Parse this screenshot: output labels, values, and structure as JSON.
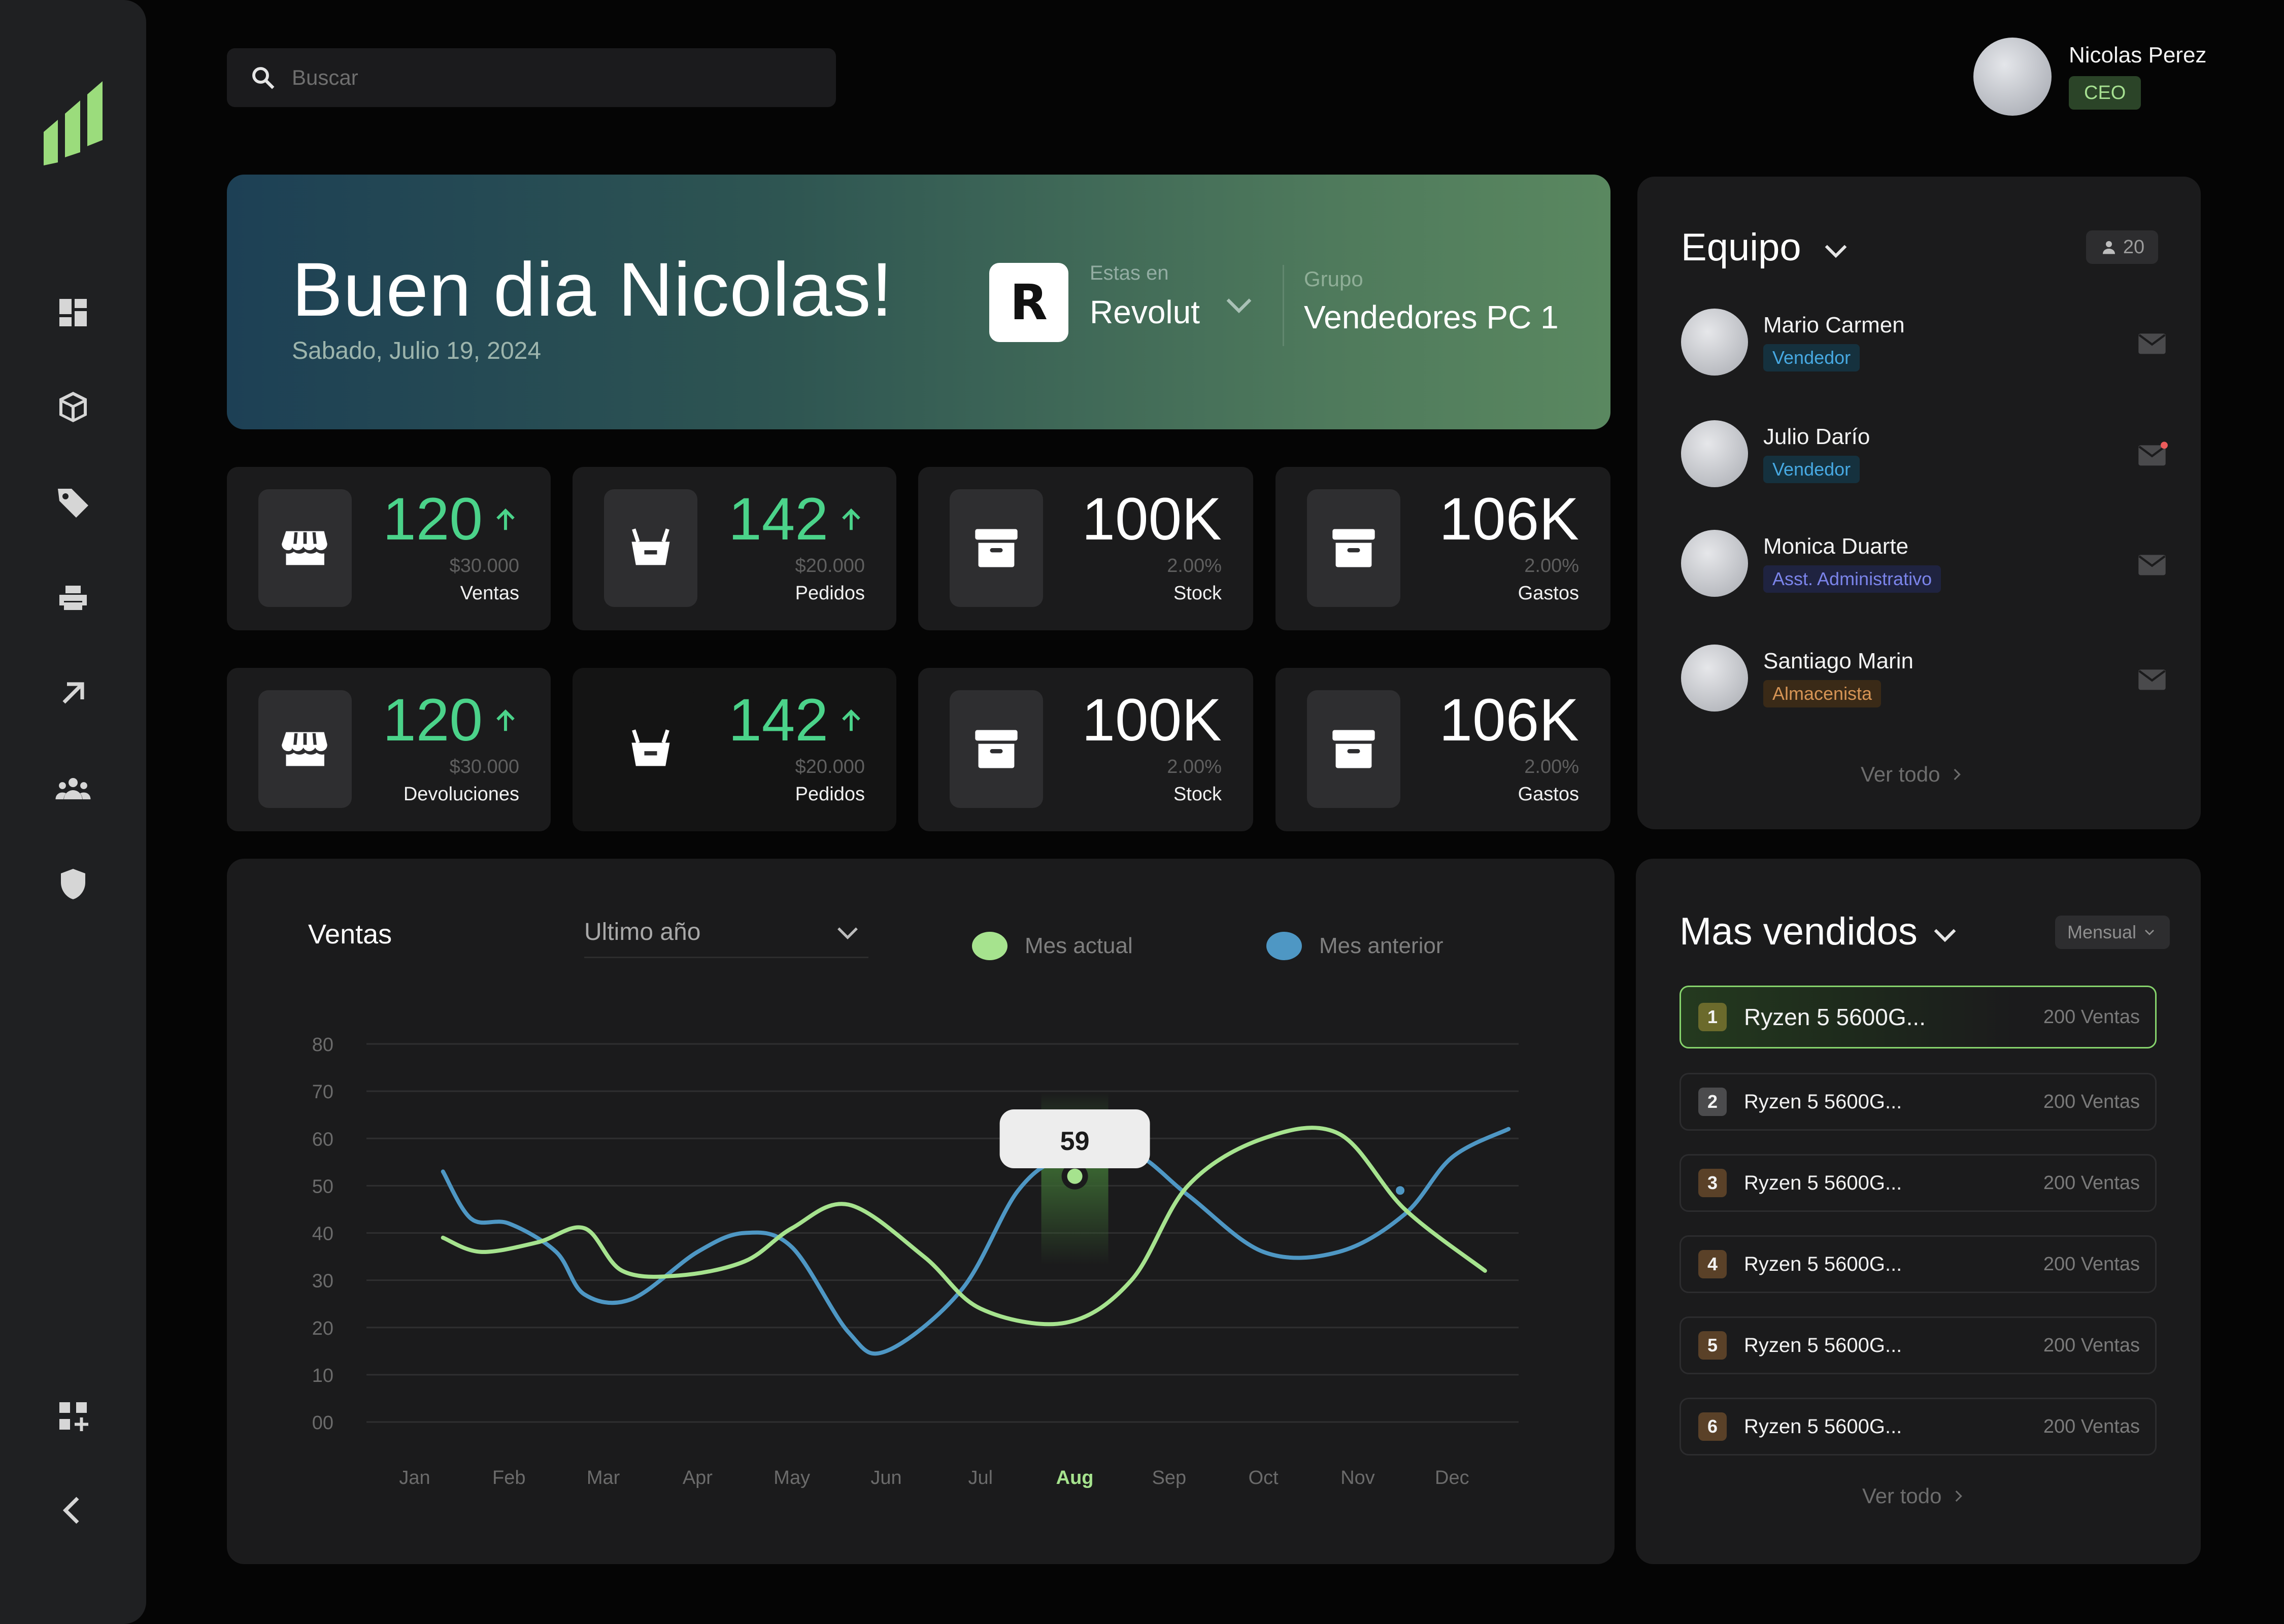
{
  "search": {
    "placeholder": "Buscar"
  },
  "user": {
    "name": "Nicolas Perez",
    "role": "CEO"
  },
  "sidebar": {
    "logo": "brand-logo",
    "items": [
      {
        "icon": "dashboard-icon"
      },
      {
        "icon": "box-icon"
      },
      {
        "icon": "tag-icon"
      },
      {
        "icon": "printer-icon"
      },
      {
        "icon": "arrow-up-right-icon"
      },
      {
        "icon": "team-icon"
      },
      {
        "icon": "shield-icon"
      }
    ],
    "bottom": [
      {
        "icon": "add-widget-icon"
      },
      {
        "icon": "collapse-icon"
      }
    ]
  },
  "hero": {
    "greeting": "Buen dia Nicolas!",
    "date": "Sabado, Julio 19, 2024",
    "company_label": "Estas en",
    "company": "Revolut",
    "group_label": "Grupo",
    "group": "Vendedores PC 1"
  },
  "stats": [
    {
      "value": "120",
      "sub": "$30.000",
      "label": "Ventas",
      "trend": "up",
      "icon": "store-icon"
    },
    {
      "value": "142",
      "sub": "$20.000",
      "label": "Pedidos",
      "trend": "up",
      "icon": "basket-icon"
    },
    {
      "value": "100K",
      "sub": "2.00%",
      "label": "Stock",
      "trend": "none",
      "icon": "archive-icon"
    },
    {
      "value": "106K",
      "sub": "2.00%",
      "label": "Gastos",
      "trend": "none",
      "icon": "archive-icon"
    },
    {
      "value": "120",
      "sub": "$30.000",
      "label": "Devoluciones",
      "trend": "up",
      "icon": "store-icon"
    },
    {
      "value": "142",
      "sub": "$20.000",
      "label": "Pedidos",
      "trend": "up",
      "icon": "basket-icon"
    },
    {
      "value": "100K",
      "sub": "2.00%",
      "label": "Stock",
      "trend": "none",
      "icon": "archive-icon"
    },
    {
      "value": "106K",
      "sub": "2.00%",
      "label": "Gastos",
      "trend": "none",
      "icon": "archive-icon"
    }
  ],
  "team": {
    "title": "Equipo",
    "count": "20",
    "members": [
      {
        "name": "Mario Carmen",
        "role": "Vendedor",
        "color": "#47a9e2",
        "unread": false
      },
      {
        "name": "Julio Darío",
        "role": "Vendedor",
        "color": "#47a9e2",
        "unread": true
      },
      {
        "name": "Monica Duarte",
        "role": "Asst. Administrativo",
        "color": "#7b84ea",
        "unread": false
      },
      {
        "name": "Santiago Marin",
        "role": "Almacenista",
        "color": "#d59455",
        "unread": false
      }
    ],
    "see_all": "Ver todo"
  },
  "sales": {
    "title": "Ventas",
    "period": "Ultimo año",
    "legend": {
      "current": "Mes actual",
      "previous": "Mes anterior"
    },
    "tooltip": "59"
  },
  "chart_data": {
    "type": "line",
    "x": [
      "Jan",
      "Feb",
      "Mar",
      "Apr",
      "May",
      "Jun",
      "Jul",
      "Aug",
      "Sep",
      "Oct",
      "Nov",
      "Dec"
    ],
    "highlight_x": "Aug",
    "yticks": [
      "00",
      "10",
      "20",
      "30",
      "40",
      "50",
      "60",
      "70",
      "80"
    ],
    "ylim": [
      0,
      80
    ],
    "series": [
      {
        "name": "Mes actual",
        "color": "#a6e38e",
        "x": [
          0.3,
          0.7,
          1.3,
          1.8,
          2.2,
          2.8,
          3.5,
          4.0,
          4.6,
          5.4,
          6.0,
          6.9,
          7.6,
          8.2,
          9.0,
          9.8,
          10.5,
          11.35
        ],
        "values": [
          39,
          36,
          38,
          41,
          32,
          31,
          34,
          41,
          46,
          35,
          24,
          21,
          30,
          50,
          60,
          61,
          45,
          32
        ]
      },
      {
        "name": "Mes anterior",
        "color": "#4e97c4",
        "x": [
          0.3,
          0.6,
          1.0,
          1.5,
          1.8,
          2.3,
          3.0,
          3.5,
          4.0,
          4.6,
          5.0,
          5.8,
          6.4,
          6.9,
          7.6,
          8.2,
          9.0,
          9.8,
          10.5,
          11.0,
          11.6
        ],
        "values": [
          53,
          43,
          42,
          36,
          27,
          26,
          36,
          40,
          37,
          19,
          15,
          28,
          49,
          56,
          57,
          48,
          36,
          36,
          44,
          56,
          62
        ]
      }
    ]
  },
  "best_sellers": {
    "title": "Mas vendidos",
    "filter": "Mensual",
    "items": [
      {
        "rank": "1",
        "name": "Ryzen 5 5600G...",
        "sales": "200 Ventas",
        "color": "#6b6a2c"
      },
      {
        "rank": "2",
        "name": "Ryzen 5 5600G...",
        "sales": "200 Ventas",
        "color": "#4b4b4d"
      },
      {
        "rank": "3",
        "name": "Ryzen 5 5600G...",
        "sales": "200 Ventas",
        "color": "#5a4128"
      },
      {
        "rank": "4",
        "name": "Ryzen 5 5600G...",
        "sales": "200 Ventas",
        "color": "#5a4128"
      },
      {
        "rank": "5",
        "name": "Ryzen 5 5600G...",
        "sales": "200 Ventas",
        "color": "#5a4128"
      },
      {
        "rank": "6",
        "name": "Ryzen 5 5600G...",
        "sales": "200 Ventas",
        "color": "#5a4128"
      }
    ],
    "see_all": "Ver todo"
  }
}
